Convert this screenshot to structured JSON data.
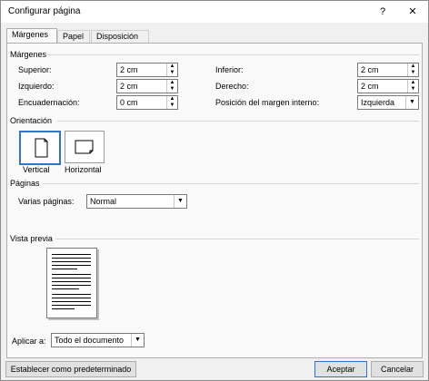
{
  "dialog": {
    "title": "Configurar página",
    "help": "?",
    "close": "✕"
  },
  "tabs": [
    "Márgenes",
    "Papel",
    "Disposición"
  ],
  "margenes": {
    "section": "Márgenes",
    "superior_label": "Superior:",
    "superior_value": "2 cm",
    "izquierdo_label": "Izquierdo:",
    "izquierdo_value": "2 cm",
    "encuadernacion_label": "Encuadernación:",
    "encuadernacion_value": "0 cm",
    "inferior_label": "Inferior:",
    "inferior_value": "2 cm",
    "derecho_label": "Derecho:",
    "derecho_value": "2 cm",
    "posicion_label": "Posición del margen interno:",
    "posicion_value": "Izquierda"
  },
  "orientacion": {
    "section": "Orientación",
    "vertical": "Vertical",
    "horizontal": "Horizontal"
  },
  "paginas": {
    "section": "Páginas",
    "varias_label": "Varias páginas:",
    "varias_value": "Normal"
  },
  "vista_previa": {
    "section": "Vista previa"
  },
  "aplicar": {
    "label": "Aplicar a:",
    "value": "Todo el documento"
  },
  "buttons": {
    "default": "Establecer como predeterminado",
    "accept": "Aceptar",
    "cancel": "Cancelar"
  }
}
